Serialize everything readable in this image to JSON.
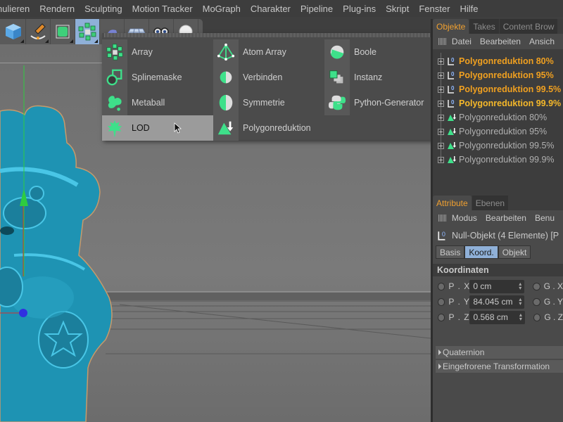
{
  "menubar": {
    "items": [
      "nulieren",
      "Rendern",
      "Sculpting",
      "Motion Tracker",
      "MoGraph",
      "Charakter",
      "Pipeline",
      "Plug-ins",
      "Skript",
      "Fenster",
      "Hilfe"
    ]
  },
  "toolbar": {
    "buttons": [
      {
        "icon": "cube-icon",
        "active": false
      },
      {
        "icon": "pen-spline-icon",
        "active": false
      },
      {
        "icon": "subdivision-cube-icon",
        "active": false
      },
      {
        "icon": "array-generator-icon",
        "active": true
      },
      {
        "icon": "deformer-icon",
        "active": false
      },
      {
        "icon": "floor-grid-icon",
        "active": false
      },
      {
        "icon": "camera-eyes-icon",
        "active": false
      },
      {
        "icon": "light-bulb-icon",
        "active": false
      }
    ]
  },
  "popup": {
    "columns": [
      [
        {
          "label": "Array",
          "icon": "array-icon"
        },
        {
          "label": "Splinemaske",
          "icon": "spline-mask-icon"
        },
        {
          "label": "Metaball",
          "icon": "metaball-icon"
        },
        {
          "label": "LOD",
          "icon": "lod-leaf-icon",
          "highlighted": true
        }
      ],
      [
        {
          "label": "Atom Array",
          "icon": "atom-array-icon"
        },
        {
          "label": "Verbinden",
          "icon": "connect-icon"
        },
        {
          "label": "Symmetrie",
          "icon": "symmetry-icon"
        },
        {
          "label": "Polygonreduktion",
          "icon": "polygon-reduction-icon"
        }
      ],
      [
        {
          "label": "Boole",
          "icon": "boole-icon"
        },
        {
          "label": "Instanz",
          "icon": "instance-icon"
        },
        {
          "label": "Python-Generator",
          "icon": "python-icon"
        }
      ]
    ]
  },
  "objects_panel": {
    "tabs": [
      {
        "label": "Objekte",
        "active": true
      },
      {
        "label": "Takes",
        "active": false
      },
      {
        "label": "Content Brow",
        "active": false
      }
    ],
    "menu": [
      "Datei",
      "Bearbeiten",
      "Ansich"
    ],
    "items": [
      {
        "label": "Polygonreduktion 80%",
        "type": "null",
        "selected": true
      },
      {
        "label": "Polygonreduktion 95%",
        "type": "null",
        "selected": true
      },
      {
        "label": "Polygonreduktion 99.5%",
        "type": "null",
        "selected": true
      },
      {
        "label": "Polygonreduktion 99.9%",
        "type": "null",
        "selected": true
      },
      {
        "label": "Polygonreduktion 80%",
        "type": "polyreduction",
        "selected": false
      },
      {
        "label": "Polygonreduktion 95%",
        "type": "polyreduction",
        "selected": false
      },
      {
        "label": "Polygonreduktion 99.5%",
        "type": "polyreduction",
        "selected": false
      },
      {
        "label": "Polygonreduktion 99.9%",
        "type": "polyreduction",
        "selected": false
      }
    ]
  },
  "attributes_panel": {
    "tabs": [
      {
        "label": "Attribute",
        "active": true
      },
      {
        "label": "Ebenen",
        "active": false
      }
    ],
    "menu": [
      "Modus",
      "Bearbeiten",
      "Benu"
    ],
    "object_title": "Null-Objekt (4 Elemente) [P",
    "subtabs": [
      {
        "label": "Basis",
        "active": false
      },
      {
        "label": "Koord.",
        "active": true
      },
      {
        "label": "Objekt",
        "active": false
      }
    ],
    "section_title": "Koordinaten",
    "coords": [
      {
        "label": "P . X",
        "value": "0 cm",
        "right_label": "G . X"
      },
      {
        "label": "P . Y",
        "value": "84.045 cm",
        "right_label": "G . Y"
      },
      {
        "label": "P . Z",
        "value": "0.568 cm",
        "right_label": "G . Z"
      }
    ],
    "folds": [
      "Quaternion",
      "Eingefrorene Transformation"
    ]
  },
  "colors": {
    "accent_orange": "#f0a020",
    "active_blue": "#8fb0d8",
    "generator_green": "#3ee08a",
    "model_cyan": "#1e9ec0"
  }
}
